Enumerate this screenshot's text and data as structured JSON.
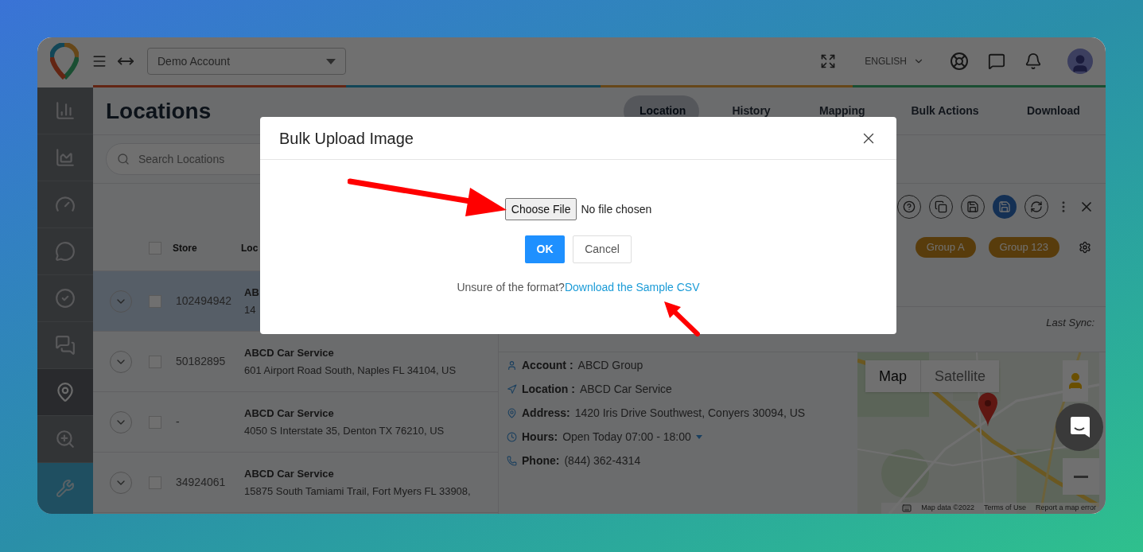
{
  "header": {
    "account_select": "Demo Account",
    "language": "ENGLISH"
  },
  "sidebar": {
    "items": [
      {
        "kind": "bar-chart",
        "selected": false
      },
      {
        "kind": "area-chart",
        "selected": false
      },
      {
        "kind": "gauge",
        "selected": false
      },
      {
        "kind": "comment",
        "selected": false
      },
      {
        "kind": "check",
        "selected": false
      },
      {
        "kind": "qa",
        "selected": false
      },
      {
        "kind": "pin",
        "selected": true
      },
      {
        "kind": "zoom",
        "selected": false
      }
    ]
  },
  "page": {
    "title": "Locations",
    "tabs": [
      {
        "label": "Location",
        "selected": true
      },
      {
        "label": "History",
        "selected": false
      },
      {
        "label": "Mapping",
        "selected": false
      },
      {
        "label": "Bulk Actions",
        "selected": false
      },
      {
        "label": "Download",
        "selected": false
      }
    ],
    "search": {
      "placeholder": "Search Locations"
    }
  },
  "table": {
    "header_checked": false,
    "columns": [
      "Store",
      "Loc"
    ],
    "rows": [
      {
        "store": "102494942",
        "name": "AB",
        "address": "14",
        "selected": true,
        "checked": false
      },
      {
        "store": "50182895",
        "name": "ABCD Car Service",
        "address": "601 Airport Road South, Naples FL 34104, US",
        "selected": false,
        "checked": false
      },
      {
        "store": "-",
        "name": "ABCD Car Service",
        "address": "4050 S Interstate 35, Denton TX 76210, US",
        "selected": false,
        "checked": false
      },
      {
        "store": "34924061",
        "name": "ABCD Car Service",
        "address": "15875 South Tamiami Trail, Fort Myers FL 33908,",
        "selected": false,
        "checked": false
      }
    ]
  },
  "details": {
    "toolbar": [
      {
        "kind": "help",
        "selected": false
      },
      {
        "kind": "copy",
        "selected": false
      },
      {
        "kind": "save",
        "selected": false
      },
      {
        "kind": "save",
        "selected": true
      },
      {
        "kind": "refresh",
        "selected": false
      }
    ],
    "groups": [
      "Group A",
      "Group 123"
    ],
    "last_sync": "Last Sync:",
    "fields": [
      {
        "kind": "account",
        "label": "Account :",
        "value": "ABCD Group"
      },
      {
        "kind": "location",
        "label": "Location :",
        "value": "ABCD Car Service"
      },
      {
        "kind": "address",
        "label": "Address:",
        "value": "1420 Iris Drive Southwest, Conyers 30094, US"
      },
      {
        "kind": "hours",
        "label": "Hours:",
        "value": "Open Today 07:00 - 18:00"
      },
      {
        "kind": "phone",
        "label": "Phone:",
        "value": "(844) 362-4314"
      }
    ]
  },
  "map": {
    "controls": [
      {
        "label": "Map",
        "selected": true
      },
      {
        "label": "Satellite",
        "selected": false
      }
    ],
    "attribution": [
      "Map data ©2022",
      "Terms of Use",
      "Report a map error"
    ]
  },
  "modal": {
    "title": "Bulk Upload Image",
    "file_button": "Choose File",
    "file_status": "No file chosen",
    "ok": "OK",
    "cancel": "Cancel",
    "hint": "Unsure of the format?",
    "link": "Download the Sample CSV"
  }
}
